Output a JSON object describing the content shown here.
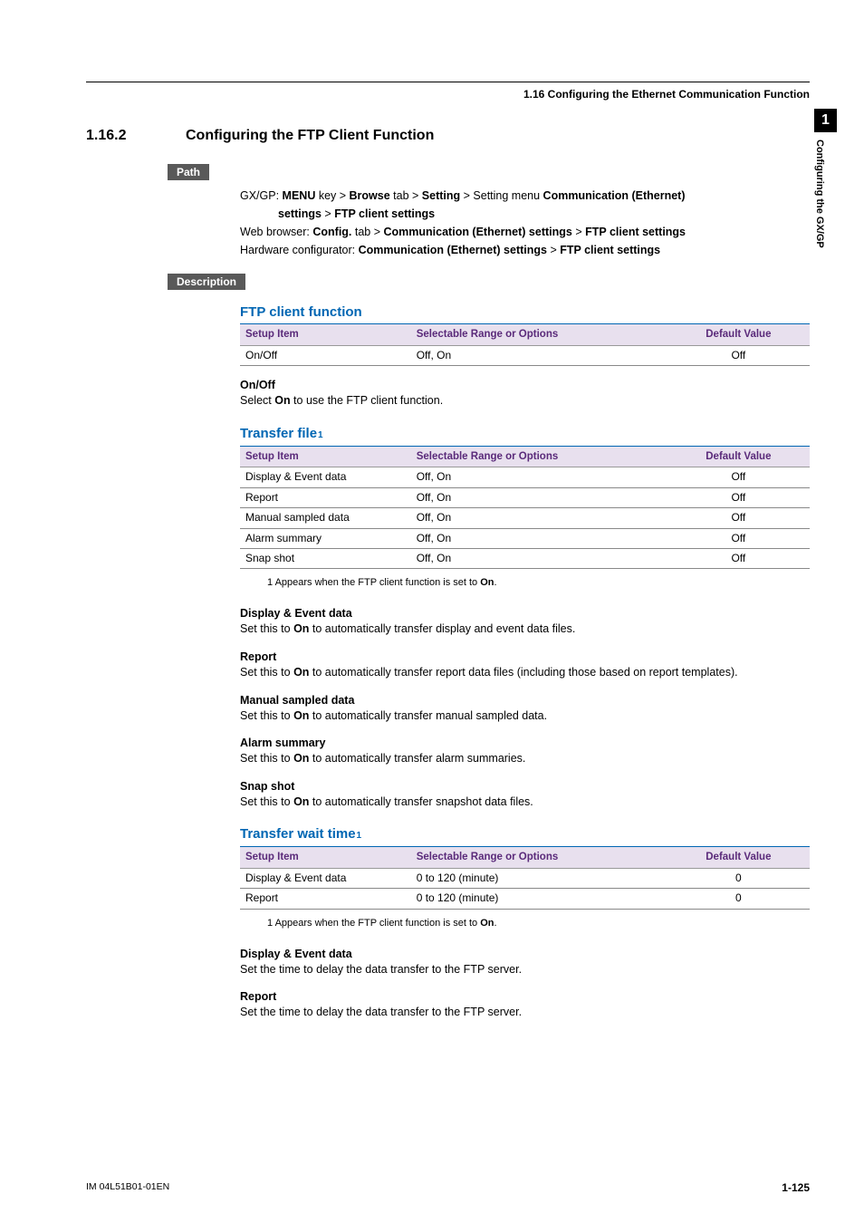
{
  "running_header": "1.16  Configuring the Ethernet Communication Function",
  "side_tab": {
    "number": "1",
    "text": "Configuring the GX/GP"
  },
  "section": {
    "number": "1.16.2",
    "title": "Configuring the FTP Client Function"
  },
  "path_label": "Path",
  "path": {
    "l1_pre": "GX/GP: ",
    "l1_b1": "MENU",
    "l1_mid1": " key > ",
    "l1_b2": "Browse",
    "l1_mid2": " tab > ",
    "l1_b3": "Setting",
    "l1_mid3": " > Setting menu ",
    "l1_b4": "Communication (Ethernet)",
    "l2_b1": "settings",
    "l2_mid1": " > ",
    "l2_b2": "FTP client settings",
    "l3_pre": "Web browser: ",
    "l3_b1": "Config.",
    "l3_mid1": " tab > ",
    "l3_b2": "Communication (Ethernet) settings",
    "l3_mid2": " > ",
    "l3_b3": "FTP client settings",
    "l4_pre": "Hardware configurator: ",
    "l4_b1": "Communication (Ethernet) settings",
    "l4_mid1": " > ",
    "l4_b2": "FTP client settings"
  },
  "desc_label": "Description",
  "table_headers": {
    "c1": "Setup Item",
    "c2": "Selectable Range or Options",
    "c3": "Default Value"
  },
  "footnote_text": "1   Appears when the FTP client function is set to ",
  "footnote_bold": "On",
  "footnote_suffix": ".",
  "sections": {
    "ftp": {
      "heading": "FTP client function",
      "rows": [
        {
          "item": "On/Off",
          "opts": "Off, On",
          "def": "Off"
        }
      ],
      "subs": [
        {
          "head": "On/Off",
          "pre": "Select ",
          "b": "On",
          "post": " to use the FTP client function."
        }
      ]
    },
    "tf": {
      "heading": "Transfer file",
      "sup": "1",
      "rows": [
        {
          "item": "Display & Event data",
          "opts": "Off, On",
          "def": "Off"
        },
        {
          "item": "Report",
          "opts": "Off, On",
          "def": "Off"
        },
        {
          "item": "Manual sampled data",
          "opts": "Off, On",
          "def": "Off"
        },
        {
          "item": "Alarm summary",
          "opts": "Off, On",
          "def": "Off"
        },
        {
          "item": "Snap shot",
          "opts": "Off, On",
          "def": "Off"
        }
      ],
      "subs": [
        {
          "head": "Display & Event data",
          "pre": "Set this to ",
          "b": "On",
          "post": " to automatically transfer display and event data files."
        },
        {
          "head": "Report",
          "pre": "Set this to ",
          "b": "On",
          "post": " to automatically transfer report data files (including those based on report templates)."
        },
        {
          "head": "Manual sampled data",
          "pre": "Set this to ",
          "b": "On",
          "post": " to automatically transfer manual sampled data."
        },
        {
          "head": "Alarm summary",
          "pre": "Set this to ",
          "b": "On",
          "post": " to automatically transfer alarm summaries."
        },
        {
          "head": "Snap shot",
          "pre": "Set this to ",
          "b": "On",
          "post": " to automatically transfer snapshot data files."
        }
      ]
    },
    "twt": {
      "heading": "Transfer wait time",
      "sup": "1",
      "rows": [
        {
          "item": "Display & Event data",
          "opts": "0 to 120 (minute)",
          "def": "0"
        },
        {
          "item": "Report",
          "opts": "0 to 120 (minute)",
          "def": "0"
        }
      ],
      "subs": [
        {
          "head": "Display & Event data",
          "text": "Set the time to delay the data transfer to the FTP server."
        },
        {
          "head": "Report",
          "text": "Set the time to delay the data transfer to the FTP server."
        }
      ]
    }
  },
  "footer": {
    "left": "IM 04L51B01-01EN",
    "right": "1-125"
  }
}
